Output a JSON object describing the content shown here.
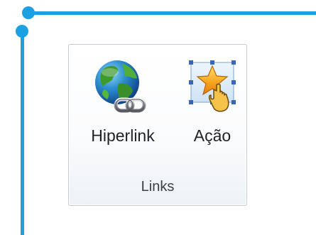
{
  "ribbon": {
    "group": {
      "label": "Links",
      "buttons": [
        {
          "label": "Hiperlink",
          "icon": "globe-chain-icon"
        },
        {
          "label": "Ação",
          "icon": "star-hand-action-icon"
        }
      ]
    }
  },
  "colors": {
    "callout": "#1ba0e2",
    "group_border": "#c6ccd4",
    "text": "#1e2126"
  }
}
